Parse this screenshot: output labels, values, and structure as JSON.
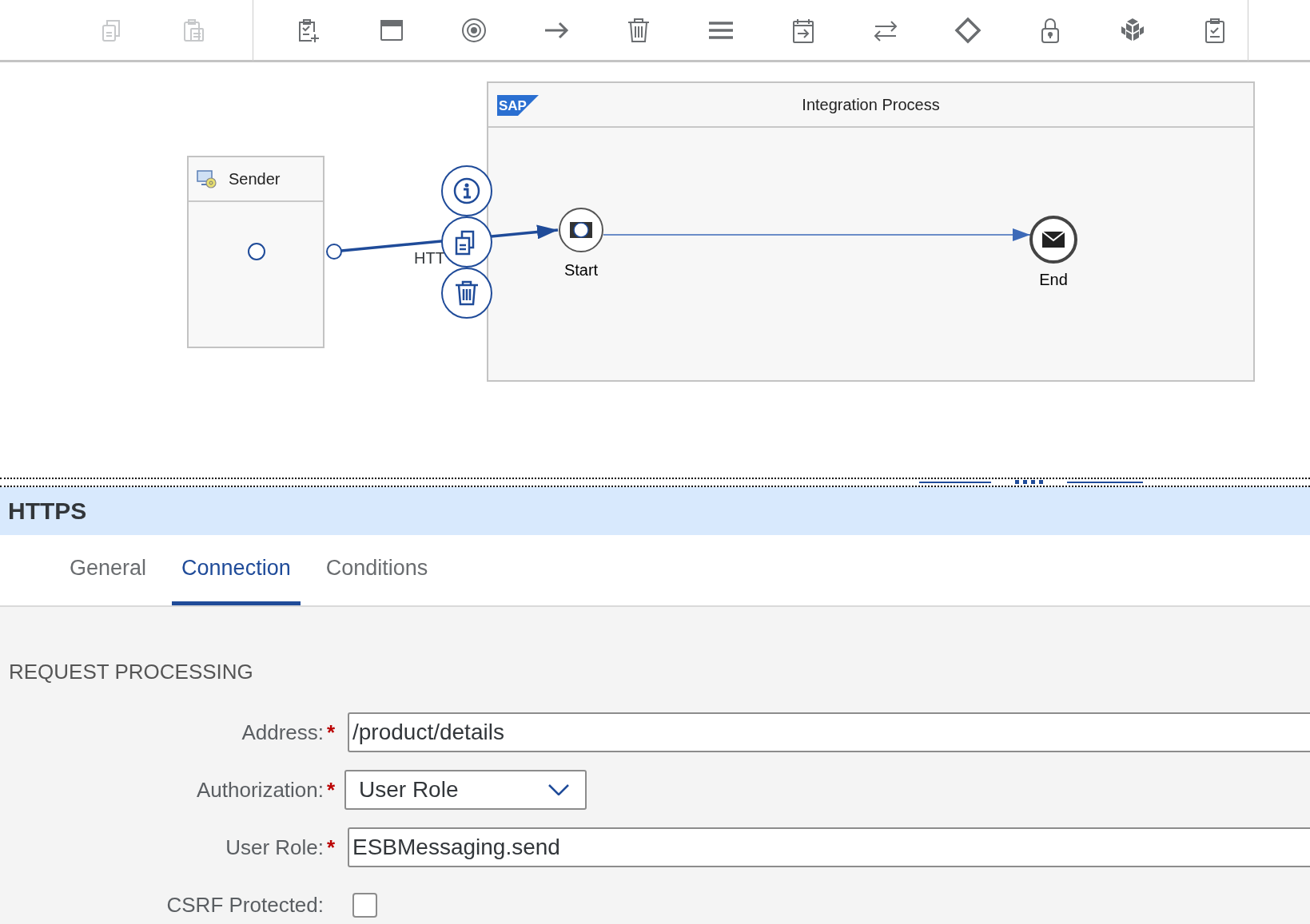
{
  "toolbar": [
    {
      "kind": "copy",
      "disabled": true
    },
    {
      "kind": "paste",
      "disabled": true
    },
    {
      "kind": "divider"
    },
    {
      "kind": "add-task",
      "disabled": false
    },
    {
      "kind": "window",
      "disabled": false
    },
    {
      "kind": "target",
      "disabled": false
    },
    {
      "kind": "arrow",
      "disabled": false
    },
    {
      "kind": "trash",
      "disabled": false
    },
    {
      "kind": "menu",
      "disabled": false
    },
    {
      "kind": "calendar",
      "disabled": false
    },
    {
      "kind": "swap",
      "disabled": false
    },
    {
      "kind": "diamond",
      "disabled": false
    },
    {
      "kind": "lock",
      "disabled": false
    },
    {
      "kind": "cubes",
      "disabled": false
    },
    {
      "kind": "clipboard",
      "disabled": false
    },
    {
      "kind": "divider"
    }
  ],
  "diagram": {
    "sender": {
      "title": "Sender"
    },
    "process": {
      "logo": "SAP",
      "title": "Integration Process"
    },
    "connection": {
      "label": "HTT"
    },
    "actions": [
      {
        "kind": "info"
      },
      {
        "kind": "copy"
      },
      {
        "kind": "delete"
      }
    ],
    "start": {
      "label": "Start"
    },
    "end": {
      "label": "End"
    }
  },
  "panel": {
    "title": "HTTPS",
    "tabs": [
      {
        "label": "General",
        "selected": false
      },
      {
        "label": "Connection",
        "selected": true
      },
      {
        "label": "Conditions",
        "selected": false
      }
    ],
    "section": "REQUEST PROCESSING",
    "fields": [
      {
        "kind": "text",
        "label": "Address:",
        "mark": "*",
        "value": "/product/details"
      },
      {
        "kind": "select",
        "label": "Authorization:",
        "mark": "*",
        "value": "User Role"
      },
      {
        "kind": "text",
        "label": "User Role:",
        "mark": "*",
        "value": "ESBMessaging.send"
      },
      {
        "kind": "checkbox",
        "label": "CSRF Protected:",
        "checked": false
      }
    ]
  }
}
